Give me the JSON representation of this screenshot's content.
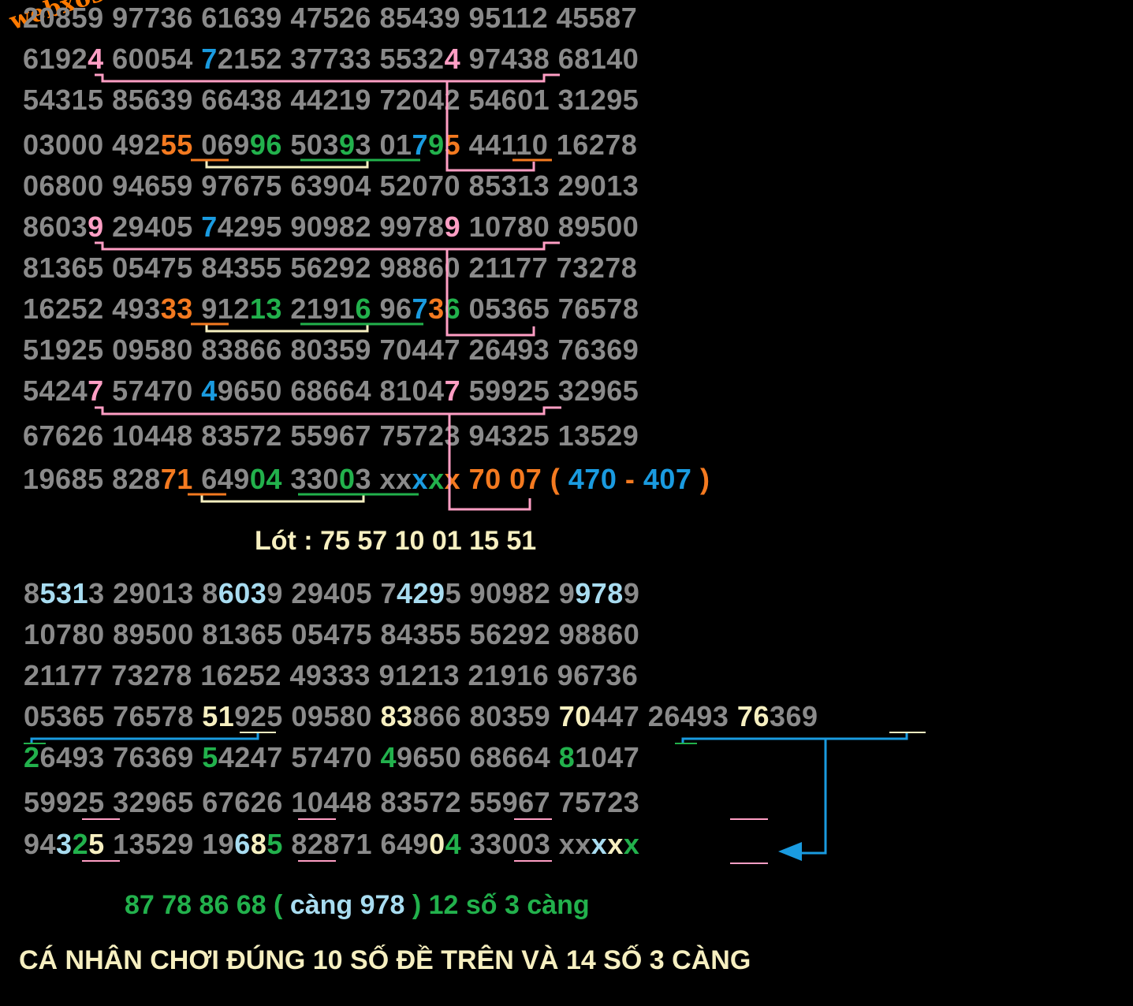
{
  "watermark": "webxoso.net",
  "table1": [
    "20859 97736 61639 47526 85439 95112 45587",
    "61924 60054 72152 37733 55324 97438 68140",
    "54315 85639 66438 44219 72042 54601 31295",
    "03000 49255 06996 50393 01795 44110 16278",
    "06800 94659 97675 63904 52070 85313 29013",
    "86039 29405 74295 90982 99789 10780 89500",
    "81365 05475 84355 56292 98860 21177 73278",
    "16252 49333 91213 21916 96736 05365 76578",
    "51925 09580 83866 80359 70447 26493 76369",
    "54247 57470 49650 68664 81047 59925 32965",
    "67626 10448 83572 55967 75723 94325 13529",
    "19685 82871 64904 33003 xxxxx"
  ],
  "prediction": {
    "main": "70 07",
    "open": "(",
    "a": "470",
    "dash": "-",
    "b": "407",
    "close": ")"
  },
  "lot": "Lót : 75 57 10 01 15 51",
  "table2": [
    "85313 29013 86039 29405 74295 90982 99789",
    "10780 89500 81365 05475 84355 56292 98860",
    "21177 73278 16252 49333 91213 21916 96736",
    "05365 76578 51925 09580 83866 80359 70447 26493 76369",
    "26493 76369 54247 57470 49650 68664 81047",
    "59925 32965 67626 10448 83572 55967 75723",
    "94325 13529 19685 82871 64904 33003 xxxxx"
  ],
  "cang_line": {
    "pre": "87 78 86 68 (",
    "mid": " càng 978 ",
    "post": ") 12 số 3 càng"
  },
  "final": "CÁ NHÂN CHƠI ĐÚNG 10 SỐ ĐỀ TRÊN VÀ 14 SỐ 3 CÀNG",
  "colors": {
    "background": "#000000",
    "digits": "#8a8a8a",
    "pink": "#ff9ec4",
    "blue": "#1a9be0",
    "orange": "#f47a20",
    "green": "#22b14c",
    "light_blue": "#a8dcf0",
    "cream": "#f6efc0"
  }
}
